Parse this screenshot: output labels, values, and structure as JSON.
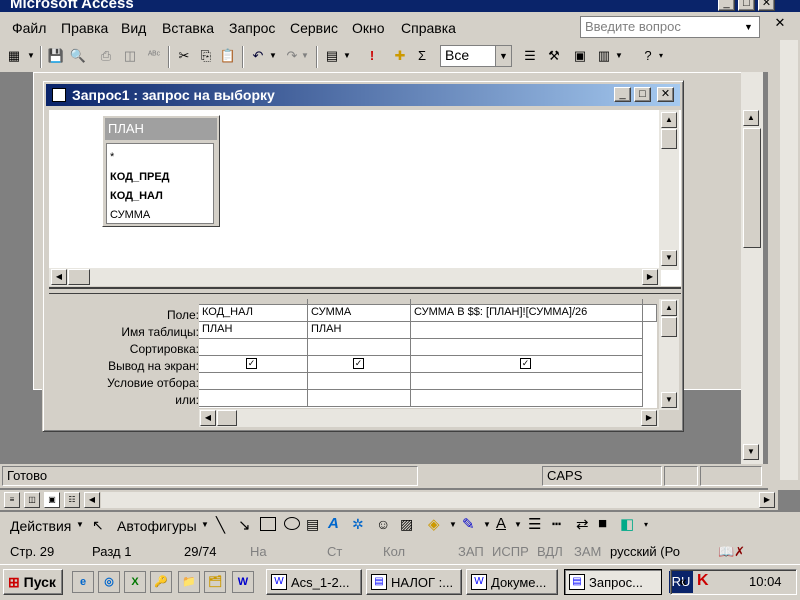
{
  "app": {
    "title": "Microsoft Access"
  },
  "menu": [
    "Файл",
    "Правка",
    "Вид",
    "Вставка",
    "Запрос",
    "Сервис",
    "Окно",
    "Справка"
  ],
  "ask_placeholder": "Введите вопрос",
  "toolbar": {
    "combo_value": "Все",
    "sigma": "Σ",
    "bang": "!"
  },
  "query_window": {
    "title": "Запрос1 : запрос на выборку"
  },
  "table": {
    "name": "ПЛАН",
    "fields": [
      {
        "label": "*",
        "bold": false
      },
      {
        "label": "КОД_ПРЕД",
        "bold": true
      },
      {
        "label": "КОД_НАЛ",
        "bold": true
      },
      {
        "label": "СУММА",
        "bold": false
      }
    ]
  },
  "grid": {
    "row_labels": [
      "Поле:",
      "Имя таблицы:",
      "Сортировка:",
      "Вывод на экран:",
      "Условие отбора:",
      "или:"
    ],
    "columns": [
      {
        "field": "КОД_НАЛ",
        "table": "ПЛАН",
        "show": true
      },
      {
        "field": "СУММА",
        "table": "ПЛАН",
        "show": true
      },
      {
        "field": "СУММА В $$: [ПЛАН]![СУММА]/26",
        "table": "",
        "show": true
      }
    ]
  },
  "status": {
    "ready": "Готово",
    "caps": "CAPS"
  },
  "draw_toolbar": {
    "actions": "Действия",
    "autoshapes": "Автофигуры"
  },
  "word_status": {
    "page": "Стр. 29",
    "section": "Разд 1",
    "pages": "29/74",
    "at": "На",
    "line": "Ст",
    "col": "Кол",
    "rec": "ЗАП",
    "trk": "ИСПР",
    "ext": "ВДЛ",
    "ovr": "ЗАМ",
    "lang": "русский (Ро"
  },
  "taskbar": {
    "start": "Пуск",
    "tasks": [
      "Acs_1-2...",
      "НАЛОГ :...",
      "Докуме...",
      "Запрос..."
    ],
    "lang": "RU",
    "time": "10:04"
  }
}
